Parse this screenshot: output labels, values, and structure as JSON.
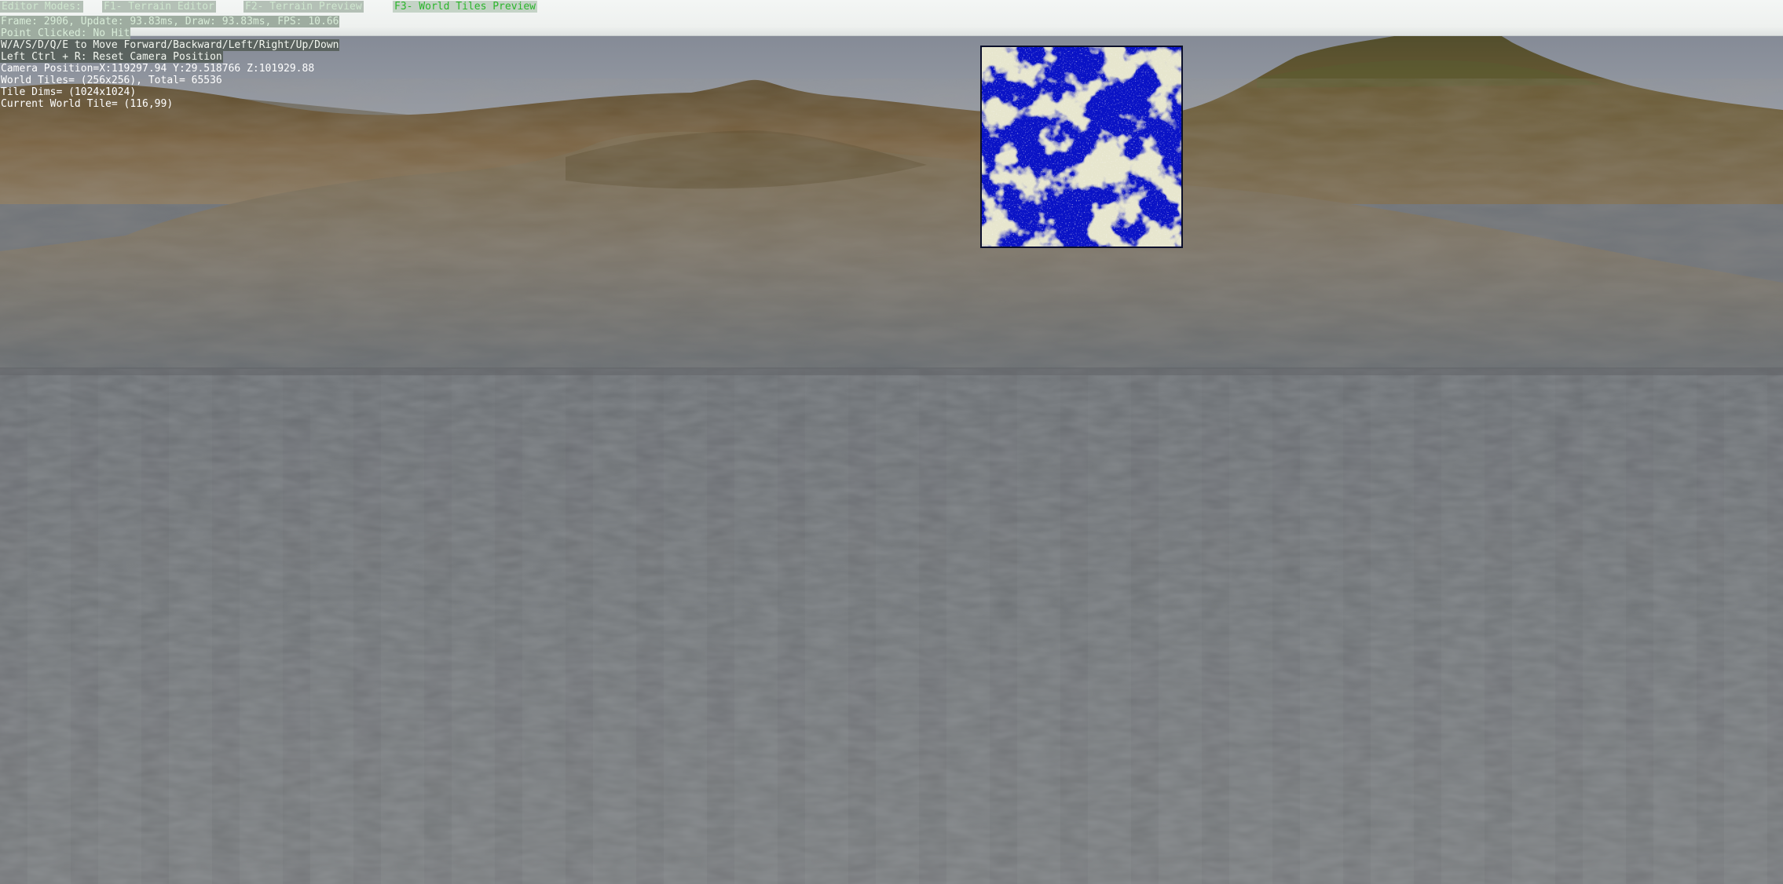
{
  "modebar": {
    "label": "Editor Modes:",
    "tabs": [
      {
        "label": "F1- Terrain Editor",
        "active": false
      },
      {
        "label": "F2- Terrain Preview",
        "active": false
      },
      {
        "label": "F3- World Tiles Preview",
        "active": true
      }
    ]
  },
  "hud": {
    "frame_stats": "Frame: 2906, Update: 93.83ms, Draw: 93.83ms, FPS: 10.66",
    "point_clicked": "Point Clicked: No Hit",
    "controls_move": "W/A/S/D/Q/E to Move Forward/Backward/Left/Right/Up/Down",
    "controls_reset": "Left Ctrl + R: Reset Camera Position",
    "camera_position": "Camera Position=X:119297.94 Y:29.518766 Z:101929.88",
    "world_tiles": "World Tiles= (256x256), Total= 65536",
    "tile_dims": "Tile Dims= (1024x1024)",
    "current_tile": "Current World Tile= (116,99)"
  },
  "colors": {
    "active_tab_text": "#2bb52b",
    "minimap_water": "#0a13c6",
    "minimap_land": "#c9c7a2",
    "sky": "#8b9099",
    "terrain": "#6f5a3a",
    "ground": "#6e7276"
  },
  "minimap": {
    "icon": "world-tiles-minimap"
  }
}
